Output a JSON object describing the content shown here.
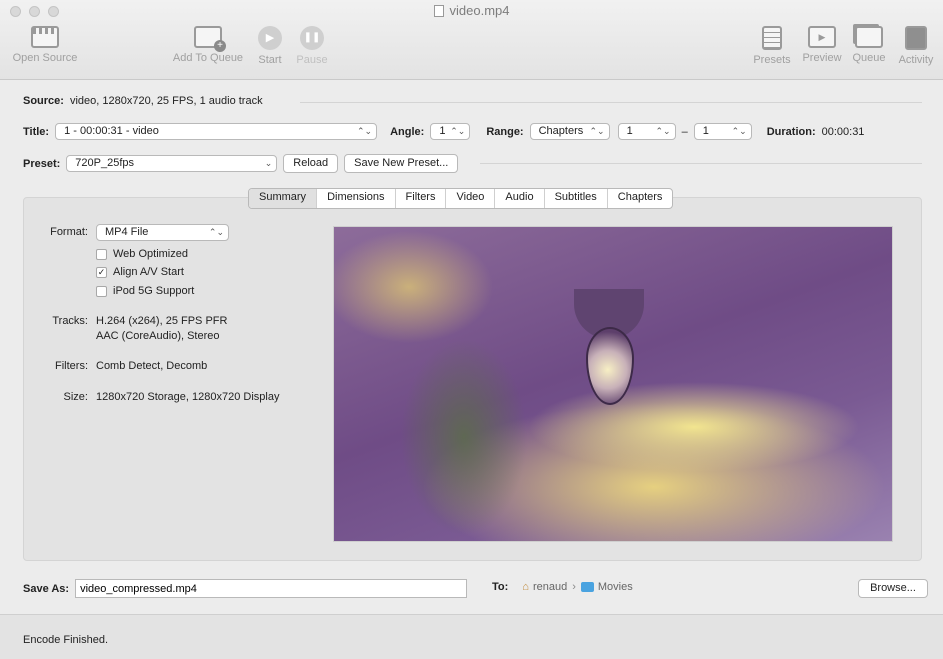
{
  "window": {
    "title": "video.mp4"
  },
  "toolbar": {
    "open_source": "Open Source",
    "add_to_queue": "Add To Queue",
    "start": "Start",
    "pause": "Pause",
    "presets": "Presets",
    "preview": "Preview",
    "queue": "Queue",
    "activity": "Activity"
  },
  "source": {
    "label": "Source:",
    "value": "video, 1280x720, 25 FPS, 1 audio track"
  },
  "title_row": {
    "title_label": "Title:",
    "title_value": "1 - 00:00:31 - video",
    "angle_label": "Angle:",
    "angle_value": "1",
    "range_label": "Range:",
    "range_value": "Chapters",
    "range_start": "1",
    "range_dash": "–",
    "range_end": "1",
    "duration_label": "Duration:",
    "duration_value": "00:00:31"
  },
  "preset_row": {
    "label": "Preset:",
    "value": "720P_25fps",
    "reload": "Reload",
    "save_new": "Save New Preset..."
  },
  "tabs": [
    "Summary",
    "Dimensions",
    "Filters",
    "Video",
    "Audio",
    "Subtitles",
    "Chapters"
  ],
  "active_tab": "Summary",
  "summary": {
    "format_label": "Format:",
    "format_value": "MP4 File",
    "web_optimized": "Web Optimized",
    "align_av": "Align A/V Start",
    "ipod": "iPod 5G Support",
    "web_optimized_checked": false,
    "align_av_checked": true,
    "ipod_checked": false,
    "tracks_label": "Tracks:",
    "tracks_line1": "H.264 (x264), 25 FPS PFR",
    "tracks_line2": "AAC (CoreAudio), Stereo",
    "filters_label": "Filters:",
    "filters_value": "Comb Detect, Decomb",
    "size_label": "Size:",
    "size_value": "1280x720 Storage, 1280x720 Display"
  },
  "save_row": {
    "label": "Save As:",
    "value": "video_compressed.mp4",
    "to_label": "To:",
    "path_home": "renaud",
    "path_sep": "›",
    "path_folder": "Movies",
    "browse": "Browse..."
  },
  "status": {
    "text": "Encode Finished."
  }
}
